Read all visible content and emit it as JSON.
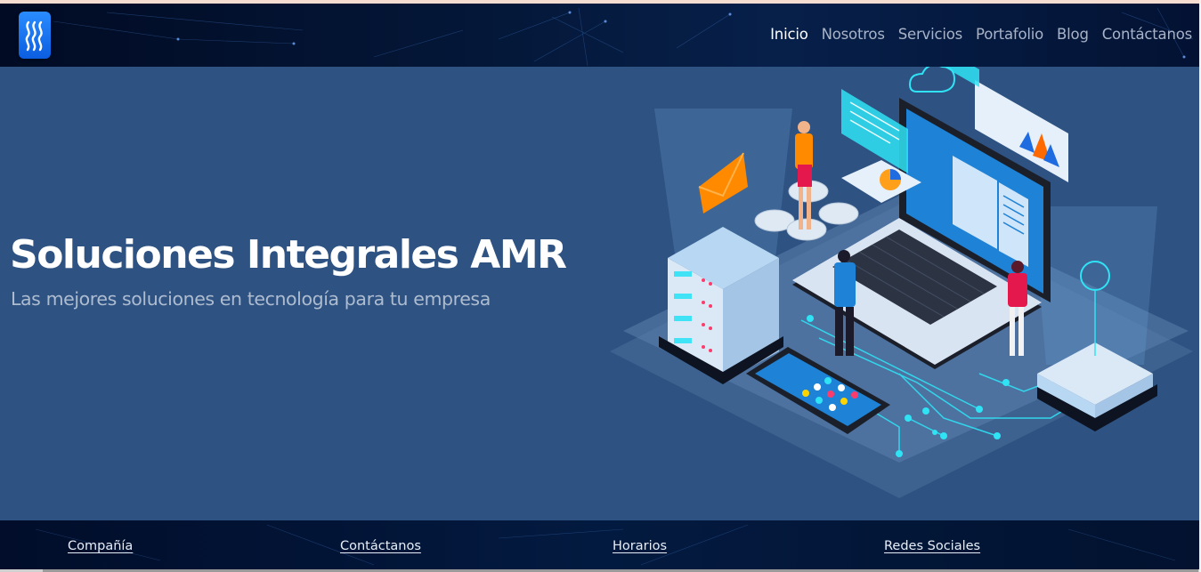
{
  "header": {
    "logo_icon": "waves-logo-icon",
    "nav": [
      {
        "label": "Inicio",
        "active": true
      },
      {
        "label": "Nosotros",
        "active": false
      },
      {
        "label": "Servicios",
        "active": false
      },
      {
        "label": "Portafolio",
        "active": false
      },
      {
        "label": "Blog",
        "active": false
      },
      {
        "label": "Contáctanos",
        "active": false
      }
    ]
  },
  "hero": {
    "title": "Soluciones Integrales AMR",
    "subtitle": "Las mejores soluciones en tecnología para tu empresa",
    "illustration": "isometric-technology-illustration"
  },
  "footer": {
    "links": [
      "Compañía",
      "Contáctanos",
      "Horarios",
      "Redes Sociales"
    ]
  },
  "colors": {
    "hero_bg": "#2e5282",
    "nav_bg": "#041738",
    "accent_cyan": "#2fe3f5",
    "logo_blue": "#1a74f0"
  }
}
